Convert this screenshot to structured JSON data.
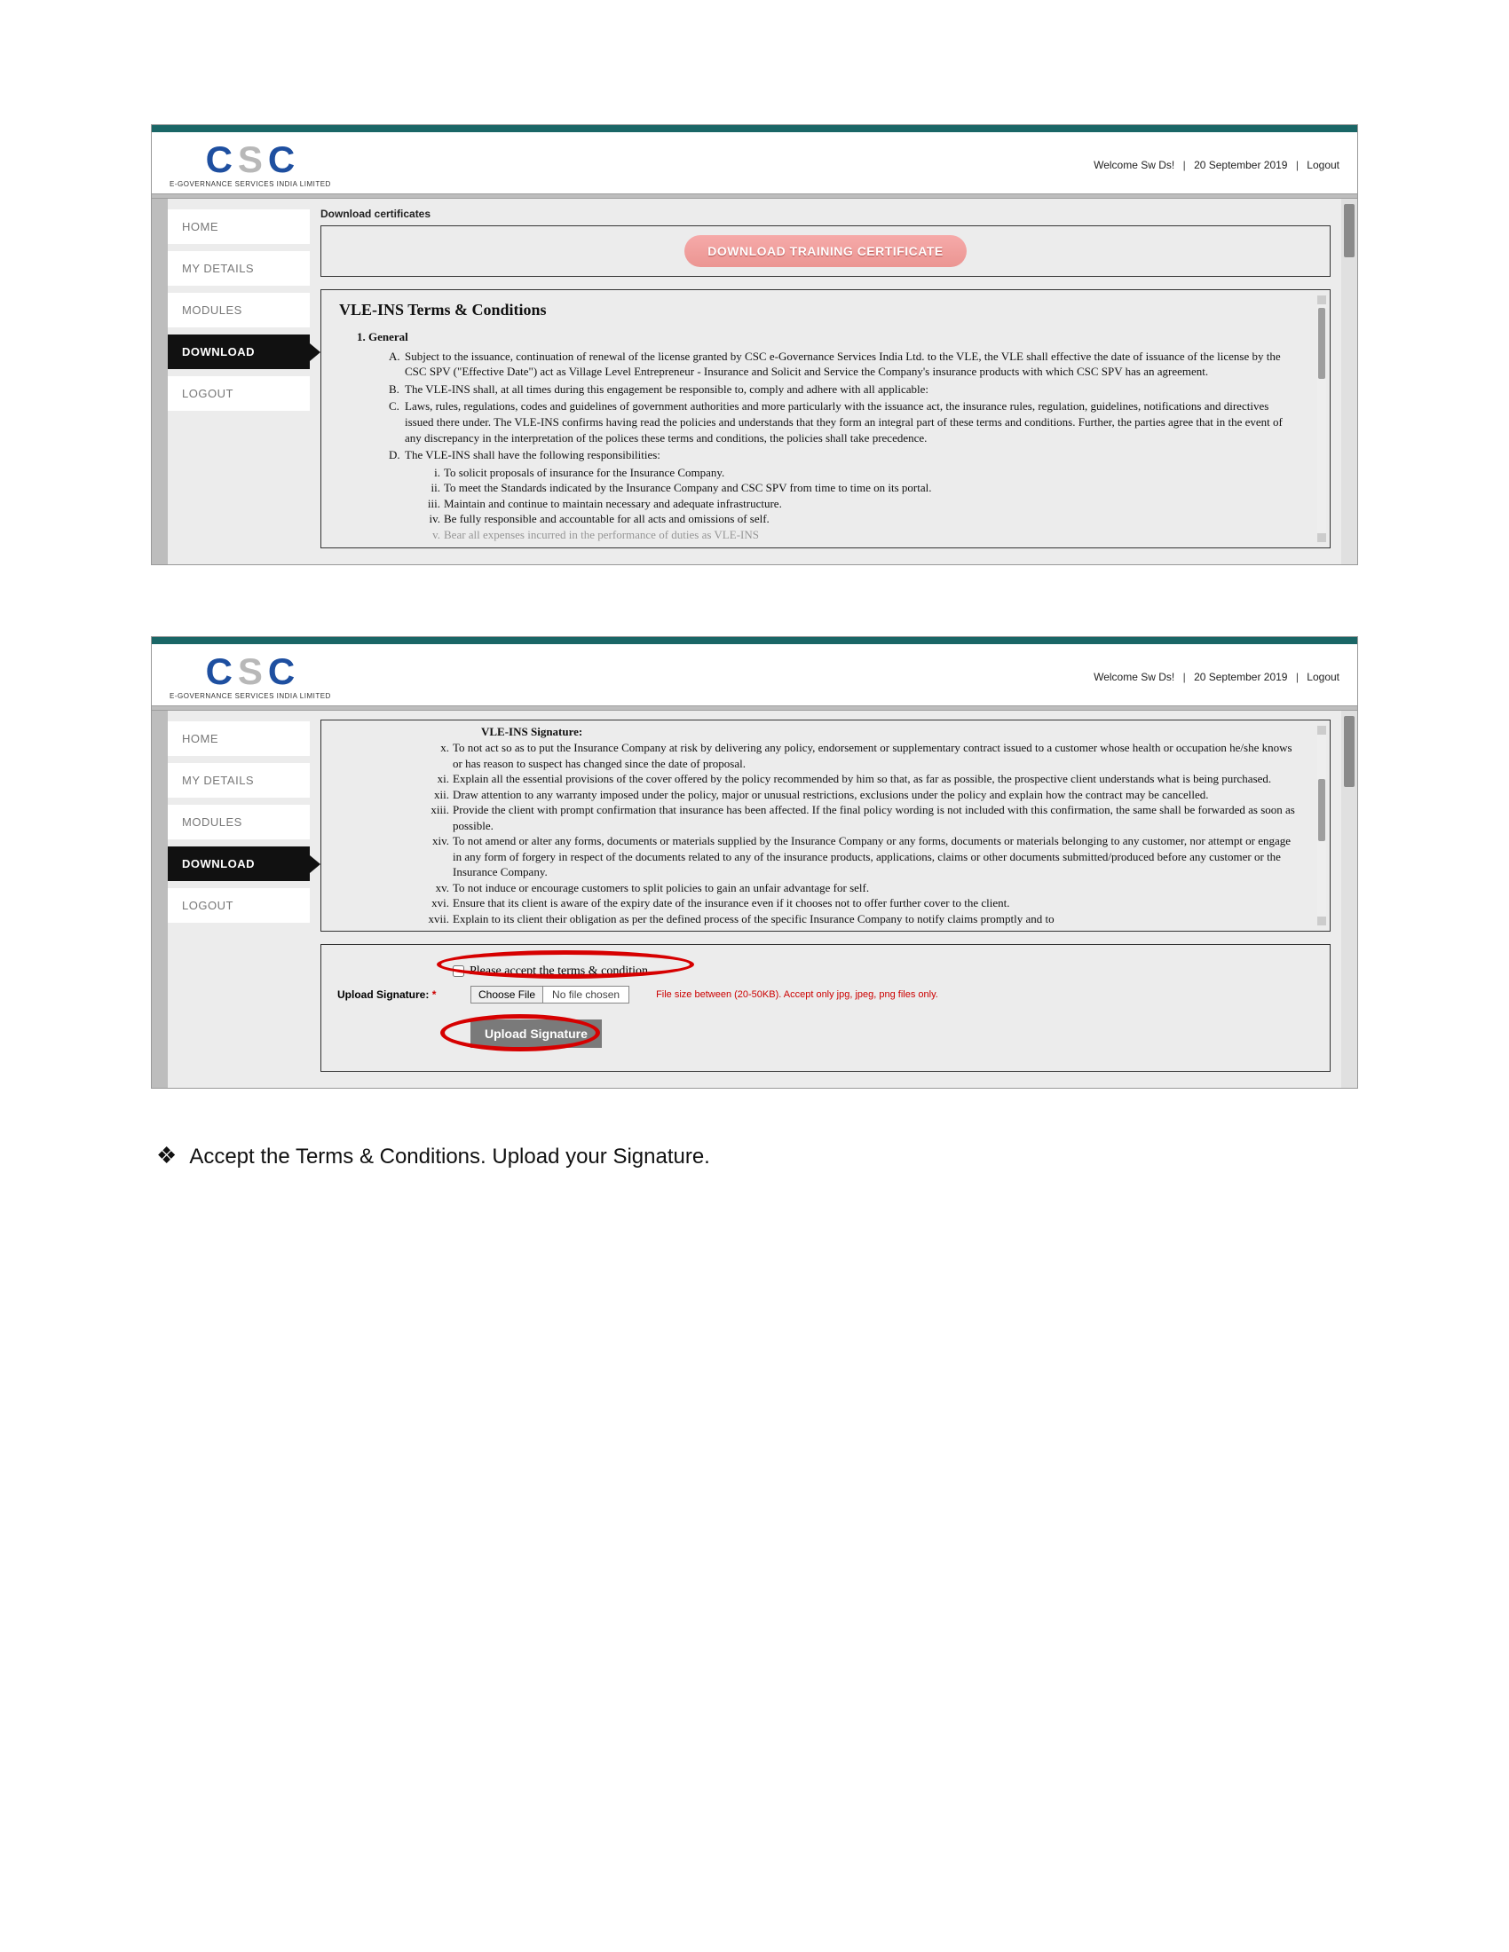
{
  "header": {
    "logo_sub": "E-GOVERNANCE SERVICES INDIA LIMITED",
    "welcome": "Welcome Sw Ds!",
    "date": "20 September 2019",
    "logout": "Logout"
  },
  "sidebar": {
    "items": [
      {
        "label": "HOME"
      },
      {
        "label": "MY DETAILS"
      },
      {
        "label": "MODULES"
      },
      {
        "label": "DOWNLOAD"
      },
      {
        "label": "LOGOUT"
      }
    ]
  },
  "top_panel": {
    "section_title": "Download certificates",
    "download_btn": "DOWNLOAD TRAINING CERTIFICATE",
    "tc_title": "VLE-INS Terms & Conditions",
    "general_label": "1. General",
    "A": "Subject to the issuance, continuation of renewal of the license granted by CSC e-Governance Services India Ltd. to the VLE, the VLE shall effective the date of issuance of the license by the CSC SPV (\"Effective Date\") act as Village Level Entrepreneur - Insurance and Solicit and Service the Company's insurance products with which CSC SPV has an agreement.",
    "B": "The VLE-INS shall, at all times during this engagement be responsible to, comply and adhere with all applicable:",
    "C": "Laws, rules, regulations, codes and guidelines of government authorities and more particularly with the issuance act, the insurance rules, regulation, guidelines, notifications and directives issued there under. The VLE-INS confirms having read the policies and understands that they form an integral part of these terms and conditions. Further, the parties agree that in the event of any discrepancy in the interpretation of the polices these terms and conditions, the policies shall take precedence.",
    "D": "The VLE-INS shall have the following responsibilities:",
    "D_i": "To solicit proposals of insurance for the Insurance Company.",
    "D_ii": "To meet the Standards indicated by the Insurance Company and CSC SPV from time to time on its portal.",
    "D_iii": "Maintain and continue to maintain necessary and adequate infrastructure.",
    "D_iv": "Be fully responsible and accountable for all acts and omissions of self.",
    "D_v_partial": "Bear all expenses incurred in the performance of duties as VLE-INS"
  },
  "bottom_panel": {
    "sig_heading": "VLE-INS Signature:",
    "x": "To not act so as to put the Insurance Company at risk by delivering any policy, endorsement or supplementary contract issued to a customer whose health or occupation he/she knows or has reason to suspect has changed since the date of proposal.",
    "xi": "Explain all the essential provisions of the cover offered by the policy recommended by him so that, as far as possible, the prospective client understands what is being purchased.",
    "xii": "Draw attention to any warranty imposed under the policy, major or unusual restrictions, exclusions under the policy and explain how the contract may be cancelled.",
    "xiii": "Provide the client with prompt confirmation that insurance has been affected. If the final policy wording is not included with this confirmation, the same shall be forwarded as soon as possible.",
    "xiv": "To not amend or alter any forms, documents or materials supplied by the Insurance Company or any forms, documents or materials belonging to any customer, nor attempt or engage in any form of forgery in respect of the documents related to any of the insurance products, applications, claims or other documents submitted/produced before any customer or the Insurance Company.",
    "xv": "To not induce or encourage customers to split policies to gain an unfair advantage for self.",
    "xvi": "Ensure that its client is aware of the expiry date of the insurance even if it chooses not to offer further cover to the client.",
    "xvii": "Explain to its client their obligation as per the defined process of the specific Insurance Company to notify claims promptly and to",
    "accept_label": "Please accept the terms & condition",
    "upload_label": "Upload Signature:",
    "choose_file": "Choose File",
    "no_file": "No file chosen",
    "file_note": "File size between (20-50KB). Accept only jpg, jpeg, png files only.",
    "upload_btn": "Upload Signature"
  },
  "instruction": "Accept the Terms & Conditions. Upload your Signature."
}
